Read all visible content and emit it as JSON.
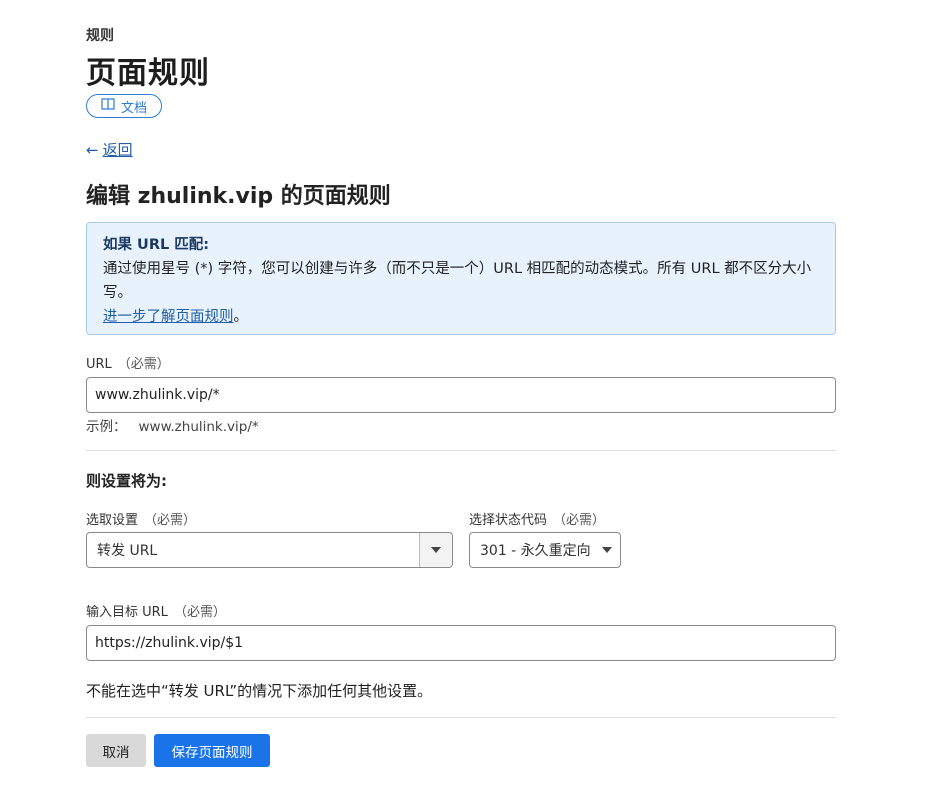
{
  "header": {
    "breadcrumb": "规则",
    "title": "页面规则",
    "docs_label": "文档"
  },
  "nav": {
    "back_label": "返回"
  },
  "edit": {
    "title": "编辑 zhulink.vip 的页面规则"
  },
  "info": {
    "heading": "如果 URL 匹配:",
    "body": "通过使用星号 (*) 字符，您可以创建与许多（而不只是一个）URL 相匹配的动态模式。所有 URL 都不区分大小写。",
    "link": "进一步了解页面规则",
    "link_suffix": "。"
  },
  "url_field": {
    "label": "URL",
    "required": "（必需）",
    "value": "www.zhulink.vip/*",
    "hint_prefix": "示例：",
    "hint_example": "www.zhulink.vip/*"
  },
  "settings": {
    "title": "则设置将为:",
    "setting_label": "选取设置",
    "setting_required": "（必需）",
    "setting_value": "转发 URL",
    "status_label": "选择状态代码",
    "status_required": "（必需）",
    "status_value": "301 - 永久重定向",
    "target_label": "输入目标 URL",
    "target_required": "（必需）",
    "target_value": "https://zhulink.vip/$1",
    "note": "不能在选中“转发 URL”的情况下添加任何其他设置。"
  },
  "actions": {
    "cancel": "取消",
    "save": "保存页面规则"
  },
  "colors": {
    "primary": "#1a73e8",
    "link": "#1f5ea8",
    "info_bg": "#e8f2fd"
  }
}
